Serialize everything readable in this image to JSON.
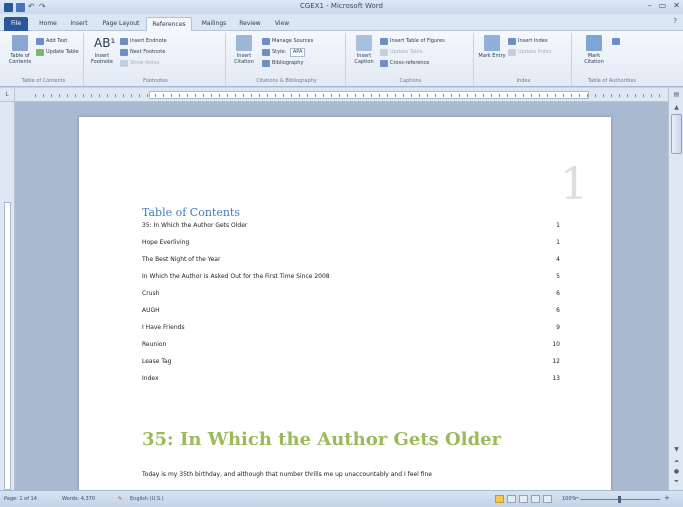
{
  "window": {
    "title": "CGEX1 - Microsoft Word",
    "controls": [
      "–",
      "▭",
      "✕"
    ]
  },
  "tabs": [
    {
      "label": "File",
      "state": "file"
    },
    {
      "label": "Home",
      "state": "normal"
    },
    {
      "label": "Insert",
      "state": "normal"
    },
    {
      "label": "Page Layout",
      "state": "normal"
    },
    {
      "label": "References",
      "state": "active"
    },
    {
      "label": "Mailings",
      "state": "normal"
    },
    {
      "label": "Review",
      "state": "normal"
    },
    {
      "label": "View",
      "state": "normal"
    }
  ],
  "ribbon": {
    "toc_group": {
      "label": "Table of Contents",
      "table_of_contents": "Table of Contents",
      "add_text": "Add Text",
      "update_table": "Update Table"
    },
    "footnotes_group": {
      "label": "Footnotes",
      "insert_footnote": "Insert Footnote",
      "insert_endnote": "Insert Endnote",
      "next_footnote": "Next Footnote",
      "show_notes": "Show Notes"
    },
    "citations_group": {
      "label": "Citations & Bibliography",
      "insert_citation": "Insert Citation",
      "manage_sources": "Manage Sources",
      "style_label": "Style:",
      "style_value": "APA",
      "bibliography": "Bibliography"
    },
    "captions_group": {
      "label": "Captions",
      "insert_caption": "Insert Caption",
      "insert_table_of_figures": "Insert Table of Figures",
      "update_table": "Update Table",
      "cross_reference": "Cross-reference"
    },
    "index_group": {
      "label": "Index",
      "mark_entry": "Mark Entry",
      "insert_index": "Insert Index",
      "update_index": "Update Index"
    },
    "authorities_group": {
      "label": "Table of Authorities",
      "mark_citation": "Mark Citation"
    }
  },
  "document": {
    "page_number_large": "1",
    "toc_heading": "Table of Contents",
    "toc_entries": [
      {
        "title": "35: In Which the Author Gets Older",
        "page": "1"
      },
      {
        "title": "Hope Everliving",
        "page": "1"
      },
      {
        "title": "The Best Night of the Year",
        "page": "4"
      },
      {
        "title": "In Which the Author is Asked Out for the First Time Since 2008",
        "page": "5"
      },
      {
        "title": "Crush",
        "page": "6"
      },
      {
        "title": "AUGH",
        "page": "6"
      },
      {
        "title": "I Have Friends",
        "page": "9"
      },
      {
        "title": "Reunion",
        "page": "10"
      },
      {
        "title": "Lease Tag",
        "page": "12"
      },
      {
        "title": "Index",
        "page": "13"
      }
    ],
    "chapter_heading": "35: In Which the Author Gets Older",
    "body_line_1": "Today is my 35th birthday, and although that number thrills me up unaccountably and I feel fine",
    "body_line_2": "..."
  },
  "statusbar": {
    "page": "Page: 1 of 14",
    "words": "Words: 4,370",
    "language": "English (U.S.)",
    "zoom": "100%"
  },
  "colors": {
    "toc_heading": "#3f7ec0",
    "chapter_heading": "#9bbb59",
    "file_tab": "#2b579a"
  }
}
